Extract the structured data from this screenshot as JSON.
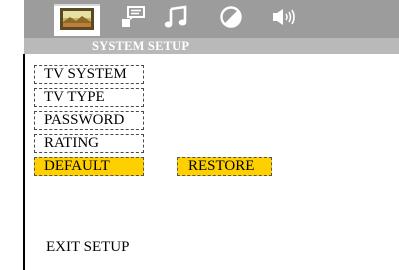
{
  "header": {
    "tabs": [
      {
        "icon": "tv-picture-icon",
        "active": true
      },
      {
        "icon": "speech-bubble-icon",
        "active": false
      },
      {
        "icon": "music-note-icon",
        "active": false
      },
      {
        "icon": "contrast-icon",
        "active": false
      },
      {
        "icon": "speaker-icon",
        "active": false
      }
    ],
    "subtitle": "SYSTEM SETUP"
  },
  "menu": {
    "items": [
      {
        "label": "TV SYSTEM"
      },
      {
        "label": "TV TYPE"
      },
      {
        "label": "PASSWORD"
      },
      {
        "label": "RATING"
      },
      {
        "label": "DEFAULT",
        "selected": true
      }
    ],
    "restore_label": "RESTORE",
    "exit_label": "EXIT SETUP"
  },
  "colors": {
    "header_bg": "#9c9c9c",
    "subbar_bg": "#b9b9b9",
    "highlight": "#ffd000"
  }
}
